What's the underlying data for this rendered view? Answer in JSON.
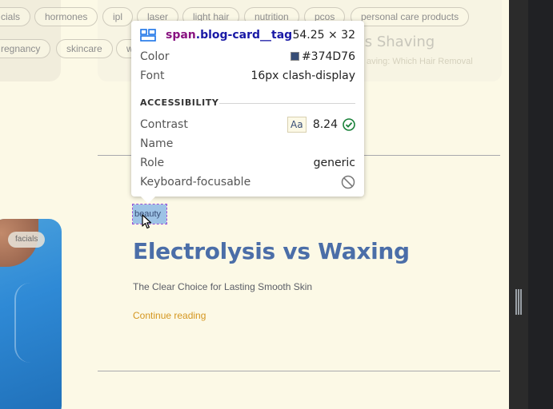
{
  "tags": [
    "cials",
    "hormones",
    "ipl",
    "laser",
    "light hair",
    "nutrition",
    "pcos",
    "personal care products",
    "regnancy",
    "skincare",
    "w"
  ],
  "faded_card": {
    "title": "s vs Shaving",
    "subtitle": "aving: Which Hair Removal"
  },
  "image_card": {
    "badge": "facials"
  },
  "blog": {
    "tag": "beauty",
    "title": "Electrolysis vs Waxing",
    "subtitle": "The Clear Choice for Lasting Smooth Skin",
    "link": "Continue reading"
  },
  "tooltip": {
    "selector_tag": "span",
    "selector_class": ".blog-card__tag",
    "size": "54.25 × 32",
    "color_label": "Color",
    "color_value": "#374D76",
    "font_label": "Font",
    "font_value": "16px clash-display",
    "accessibility_label": "ACCESSIBILITY",
    "contrast_label": "Contrast",
    "contrast_sample": "Aa",
    "contrast_value": "8.24",
    "name_label": "Name",
    "name_value": "",
    "role_label": "Role",
    "role_value": "generic",
    "focusable_label": "Keyboard-focusable"
  },
  "colors": {
    "background": "#fcf9e6",
    "tag_text": "#374d76",
    "title": "#4b6ea8",
    "link": "#d4961f",
    "highlight": "#9ec3e6"
  }
}
